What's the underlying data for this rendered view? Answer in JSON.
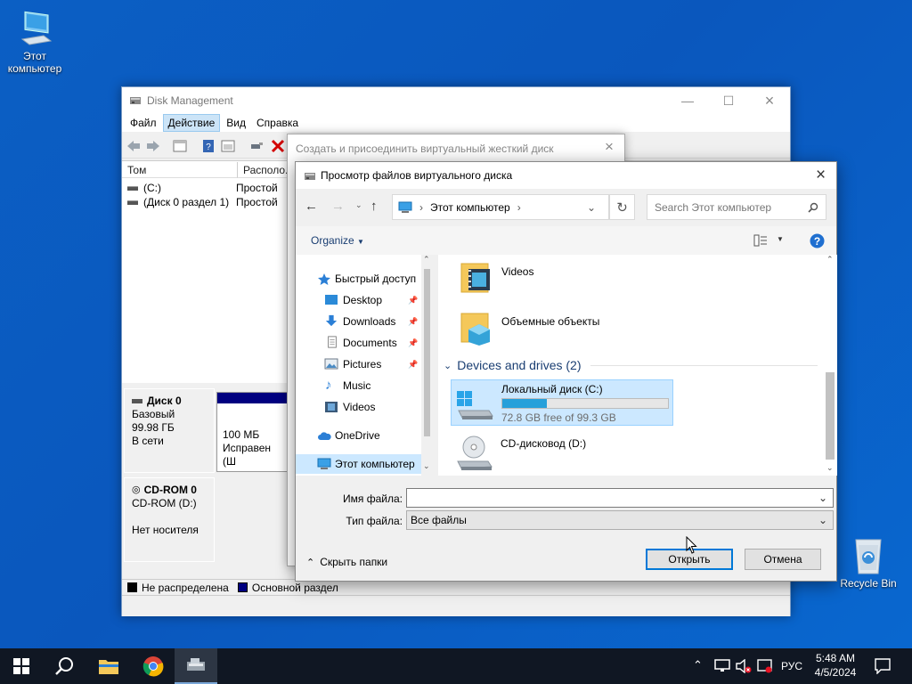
{
  "desktop": {
    "this_pc_label": "Этот компьютер",
    "recycle_bin_label": "Recycle Bin"
  },
  "disk_mgmt": {
    "title": "Disk Management",
    "menu": [
      "Файл",
      "Действие",
      "Вид",
      "Справка"
    ],
    "columns": [
      "Том",
      "Располо..."
    ],
    "volumes": [
      {
        "name": "(C:)",
        "layout": "Простой"
      },
      {
        "name": "(Диск 0 раздел 1)",
        "layout": "Простой"
      }
    ],
    "disk0": {
      "name": "Диск 0",
      "type": "Базовый",
      "size": "99.98 ГБ",
      "status": "В сети",
      "partition_size": "100 МБ",
      "partition_status": "Исправен (Ш"
    },
    "cdrom0": {
      "name": "CD-ROM 0",
      "type": "CD-ROM (D:)",
      "status": "Нет носителя"
    },
    "legend": [
      "Не распределена",
      "Основной раздел"
    ]
  },
  "vhd_dialog": {
    "title": "Создать и присоединить виртуальный жесткий диск"
  },
  "file_dialog": {
    "title": "Просмотр файлов виртуального диска",
    "address_location": "Этот компьютер",
    "search_placeholder": "Search Этот компьютер",
    "organize_label": "Organize",
    "nav": {
      "quick_access": "Быстрый доступ",
      "desktop": "Desktop",
      "downloads": "Downloads",
      "documents": "Documents",
      "pictures": "Pictures",
      "music": "Music",
      "videos": "Videos",
      "onedrive": "OneDrive",
      "this_pc": "Этот компьютер"
    },
    "folders": {
      "videos": "Videos",
      "objects3d": "Объемные объекты"
    },
    "group_header": "Devices and drives (2)",
    "drive_c": {
      "name": "Локальный диск (C:)",
      "free": "72.8 GB free of 99.3 GB",
      "used_fraction": 0.267
    },
    "drive_d": {
      "name": "CD-дисковод (D:)"
    },
    "filename_label": "Имя файла:",
    "filename_value": "",
    "filetype_label": "Тип файла:",
    "filetype_value": "Все файлы",
    "open_button": "Открыть",
    "cancel_button": "Отмена",
    "hide_folders": "Скрыть папки"
  },
  "taskbar": {
    "lang": "РУС",
    "time": "5:48 AM",
    "date": "4/5/2024"
  },
  "colors": {
    "desktop": "#0b5fc4",
    "accent": "#0078d7",
    "primary_partition": "#000080",
    "taskbar": "#101723"
  }
}
